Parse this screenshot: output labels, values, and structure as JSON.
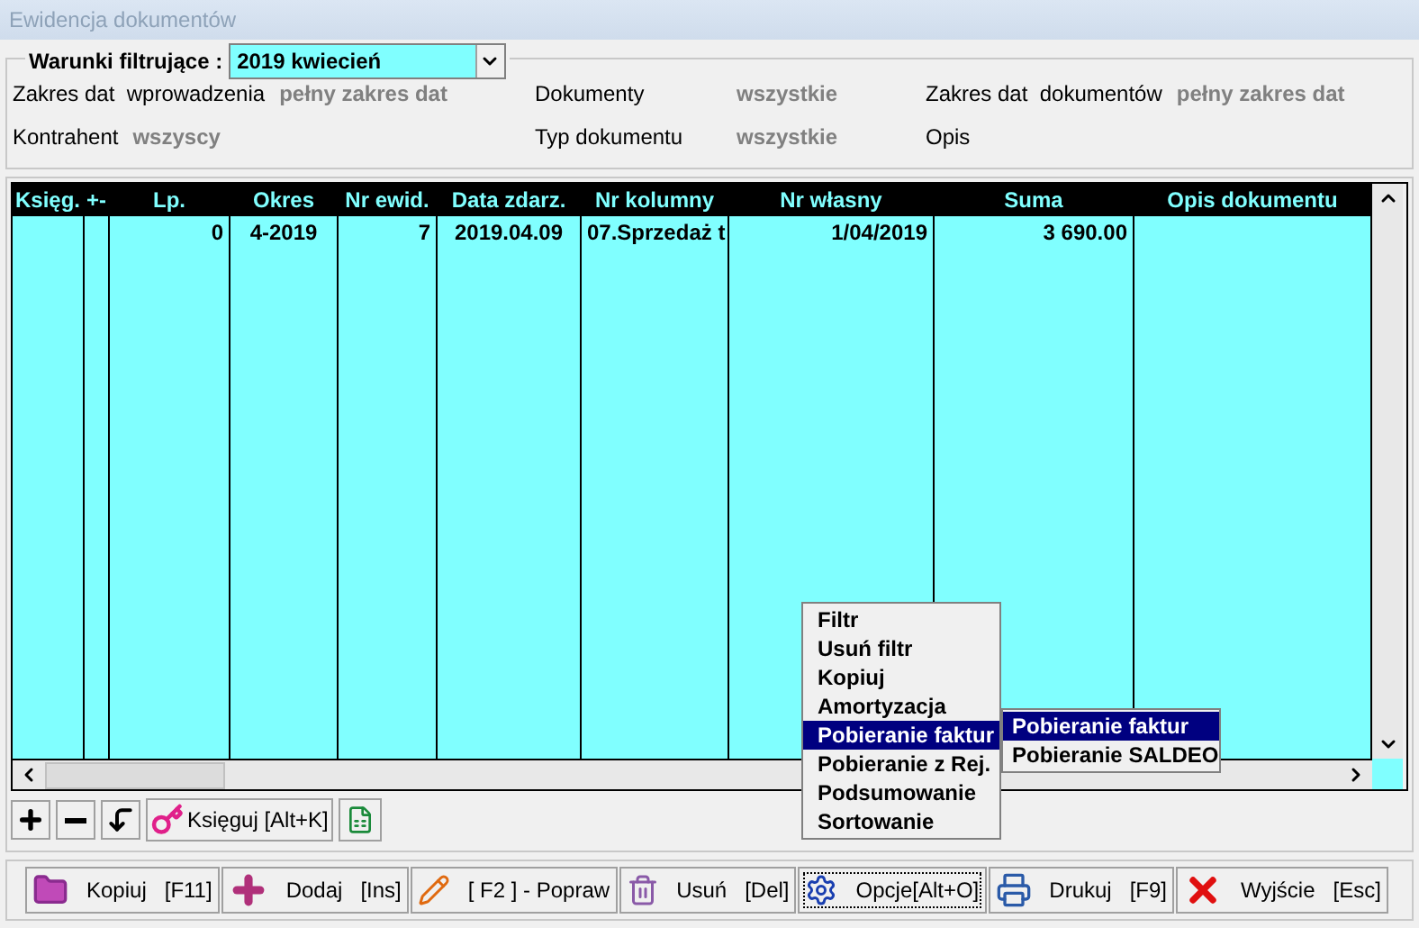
{
  "window": {
    "title": "Ewidencja dokumentów"
  },
  "filter": {
    "label": "Warunki filtrujące :",
    "value": "2019 kwiecień",
    "fields": [
      {
        "label": "Zakres dat  wprowadzenia",
        "value": "pełny zakres dat"
      },
      {
        "label": "Dokumenty",
        "value": "wszystkie"
      },
      {
        "label": "Zakres dat  dokumentów",
        "value": "pełny zakres dat"
      },
      {
        "label": "Kontrahent",
        "value": "wszyscy"
      },
      {
        "label": "Typ dokumentu",
        "value": "wszystkie"
      },
      {
        "label": "Opis"
      }
    ]
  },
  "table": {
    "columns": [
      "Księg.",
      "+-",
      "Lp.",
      "Okres",
      "Nr ewid.",
      "Data zdarz.",
      "Nr kolumny",
      "Nr własny",
      "Suma",
      "Opis dokumentu"
    ],
    "rows": [
      [
        "",
        "",
        "0",
        "4-2019",
        "7",
        "2019.04.09",
        "07.Sprzedaż t",
        "1/04/2019",
        "3 690.00",
        ""
      ]
    ]
  },
  "small_toolbar": {
    "posting_button": "Księguj [Alt+K]"
  },
  "context_menu": {
    "items": [
      {
        "label": "Filtr",
        "selected": false
      },
      {
        "label": "Usuń filtr",
        "selected": false
      },
      {
        "label": "Kopiuj",
        "selected": false
      },
      {
        "label": "Amortyzacja",
        "selected": false
      },
      {
        "label": "Pobieranie faktur",
        "selected": true
      },
      {
        "label": "Pobieranie z Rej.",
        "selected": false
      },
      {
        "label": "Podsumowanie",
        "selected": false
      },
      {
        "label": "Sortowanie",
        "selected": false
      }
    ],
    "submenu": [
      {
        "label": "Pobieranie faktur",
        "selected": true
      },
      {
        "label": "Pobieranie SALDEO",
        "selected": false
      }
    ]
  },
  "buttons": [
    {
      "kind": "copy",
      "label": "Kopiuj",
      "shortcut": "[F11]"
    },
    {
      "kind": "add",
      "label": "Dodaj",
      "shortcut": "[Ins]"
    },
    {
      "kind": "edit",
      "label": "[ F2 ] - Popraw"
    },
    {
      "kind": "delete",
      "label": "Usuń",
      "shortcut": "[Del]"
    },
    {
      "kind": "options",
      "label": "Opcje[Alt+O]",
      "focused": true
    },
    {
      "kind": "print",
      "label": "Drukuj",
      "shortcut": "[F9]"
    },
    {
      "kind": "exit",
      "label": "Wyjście",
      "shortcut": "[Esc]"
    }
  ]
}
